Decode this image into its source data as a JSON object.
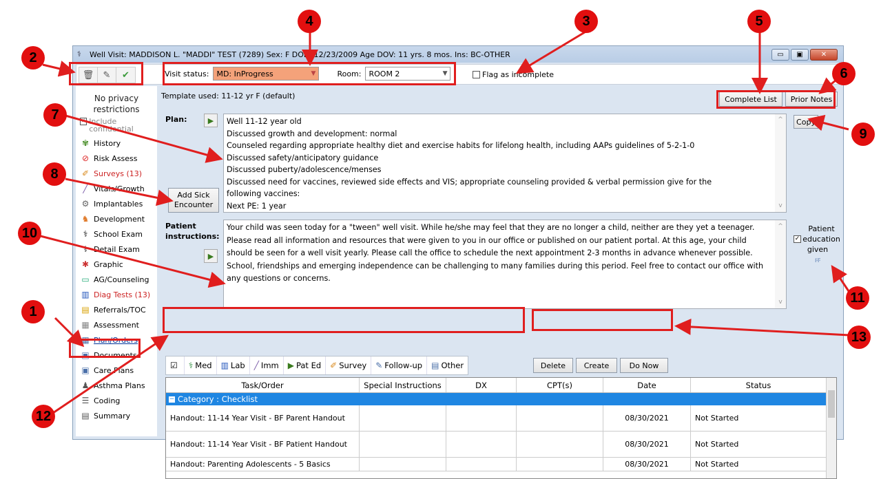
{
  "window": {
    "title": "Well Visit: MADDISON L. \"MADDI\" TEST (7289)  Sex: F  DOB: 12/23/2009  Age DOV: 11 yrs. 8 mos.  Ins: BC-OTHER",
    "min": "▭",
    "max": "▣",
    "close": "✕"
  },
  "toolbar": {
    "visit_status_label": "Visit status:",
    "visit_status_value": "MD: InProgress",
    "room_label": "Room:",
    "room_value": "ROOM 2",
    "flag_label": "Flag as incomplete"
  },
  "sidebar": {
    "privacy": "No privacy restrictions",
    "include_conf": "Include confidential",
    "items": [
      {
        "label": "History",
        "icon": "history-icon"
      },
      {
        "label": "Risk Assess",
        "icon": "risk-icon"
      },
      {
        "label": "Surveys (13)",
        "icon": "survey-icon"
      },
      {
        "label": "Vitals/Growth",
        "icon": "vitals-icon"
      },
      {
        "label": "Implantables",
        "icon": "implant-icon"
      },
      {
        "label": "Development",
        "icon": "development-icon"
      },
      {
        "label": "School Exam",
        "icon": "stethoscope-icon"
      },
      {
        "label": "Detail Exam",
        "icon": "stethoscope-icon"
      },
      {
        "label": "Graphic",
        "icon": "graphic-icon"
      },
      {
        "label": "AG/Counseling",
        "icon": "counseling-icon"
      },
      {
        "label": "Diag Tests (13)",
        "icon": "lab-icon"
      },
      {
        "label": "Referrals/TOC",
        "icon": "referral-icon"
      },
      {
        "label": "Assessment",
        "icon": "assessment-icon"
      },
      {
        "label": "Plan/Orders",
        "icon": "plan-icon"
      },
      {
        "label": "Documents",
        "icon": "document-icon"
      },
      {
        "label": "Care Plans",
        "icon": "careplan-icon"
      },
      {
        "label": "Asthma Plans",
        "icon": "asthma-icon"
      },
      {
        "label": "Coding",
        "icon": "coding-icon"
      },
      {
        "label": "Summary",
        "icon": "summary-icon"
      }
    ]
  },
  "main": {
    "template_used": "Template used:  11-12 yr F (default)",
    "complete_list": "Complete List",
    "prior_notes": "Prior Notes",
    "plan_label": "Plan:",
    "add_sick": "Add Sick Encounter",
    "copy": "Copy",
    "plan_lines": [
      "Well 11-12 year old",
      "Discussed growth and development: normal",
      "Counseled regarding appropriate healthy diet and exercise habits for lifelong health, including AAPs guidelines of 5-2-1-0",
      "Discussed safety/anticipatory guidance",
      "Discussed puberty/adolescence/menses",
      "Discussed need for vaccines, reviewed side effects and VIS; appropriate counseling provided &  verbal permission give for the",
      "following vaccines:",
      "Next PE: 1 year"
    ],
    "patient_instructions_label": "Patient instructions:",
    "patient_instructions": "Your child was seen today for a \"tween\" well visit. While he/she may feel that they are no longer a child, neither are they yet a teenager. Please read all information and resources that were given to you in our office or published on our patient portal. At this age, your child should be seen for a well visit yearly. Please call the office to schedule the next appointment 2-3 months in advance whenever possible. School, friendships and emerging independence can be challenging to many families during this period. Feel free to contact our office with any questions or concerns.",
    "patient_education": "Patient education given"
  },
  "tabs": [
    {
      "label": "",
      "icon": "checklist-icon"
    },
    {
      "label": "Med",
      "icon": "med-icon"
    },
    {
      "label": "Lab",
      "icon": "lab-icon"
    },
    {
      "label": "Imm",
      "icon": "imm-icon"
    },
    {
      "label": "Pat Ed",
      "icon": "pated-icon"
    },
    {
      "label": "Survey",
      "icon": "survey-icon"
    },
    {
      "label": "Follow-up",
      "icon": "followup-icon"
    },
    {
      "label": "Other",
      "icon": "other-icon"
    }
  ],
  "actions": {
    "delete": "Delete",
    "create": "Create",
    "do_now": "Do Now"
  },
  "grid": {
    "columns": [
      "Task/Order",
      "Special Instructions",
      "DX",
      "CPT(s)",
      "Date",
      "Status"
    ],
    "category": "Category : Checklist",
    "rows": [
      [
        "Handout: 11-14 Year Visit - BF Parent Handout",
        "",
        "",
        "",
        "08/30/2021",
        "Not Started"
      ],
      [
        "Handout: 11-14 Year Visit - BF Patient Handout",
        "",
        "",
        "",
        "08/30/2021",
        "Not Started"
      ],
      [
        "Handout: Parenting Adolescents - 5 Basics",
        "",
        "",
        "",
        "08/30/2021",
        "Not Started"
      ]
    ]
  },
  "callouts": [
    "1",
    "2",
    "3",
    "4",
    "5",
    "6",
    "7",
    "8",
    "9",
    "10",
    "11",
    "12",
    "13"
  ]
}
